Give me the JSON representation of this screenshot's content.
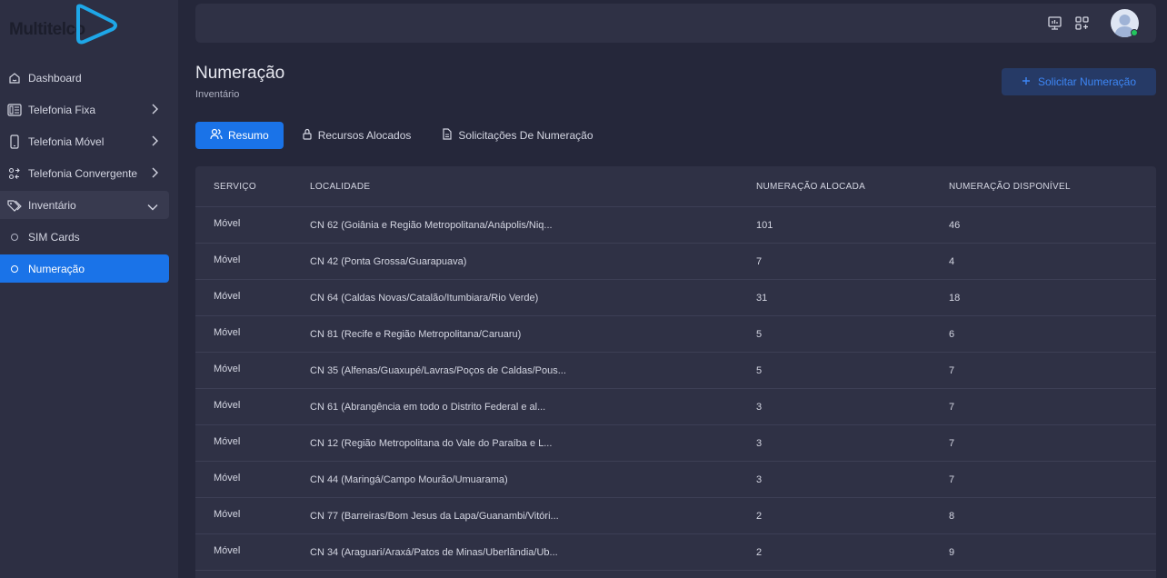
{
  "brand": {
    "name": "Multitelco"
  },
  "sidebar": {
    "items": [
      {
        "label": "Dashboard"
      },
      {
        "label": "Telefonia Fixa"
      },
      {
        "label": "Telefonia Móvel"
      },
      {
        "label": "Telefonia Convergente"
      },
      {
        "label": "Inventário"
      },
      {
        "label": "SIM Cards"
      },
      {
        "label": "Numeração"
      }
    ]
  },
  "header": {
    "title": "Numeração",
    "subtitle": "Inventário",
    "request_button": "Solicitar Numeração"
  },
  "tabs": [
    {
      "label": "Resumo"
    },
    {
      "label": "Recursos Alocados"
    },
    {
      "label": "Solicitações De Numeração"
    }
  ],
  "table": {
    "columns": [
      "SERVIÇO",
      "LOCALIDADE",
      "NUMERAÇÃO ALOCADA",
      "NUMERAÇÃO DISPONÍVEL"
    ],
    "rows": [
      {
        "servico": "Móvel",
        "localidade": "CN 62 (Goiânia e Região Metropolitana/Anápolis/Niq...",
        "alocada": "101",
        "disponivel": "46"
      },
      {
        "servico": "Móvel",
        "localidade": "CN 42 (Ponta Grossa/Guarapuava)",
        "alocada": "7",
        "disponivel": "4"
      },
      {
        "servico": "Móvel",
        "localidade": "CN 64 (Caldas Novas/Catalão/Itumbiara/Rio Verde)",
        "alocada": "31",
        "disponivel": "18"
      },
      {
        "servico": "Móvel",
        "localidade": "CN 81 (Recife e Região Metropolitana/Caruaru)",
        "alocada": "5",
        "disponivel": "6"
      },
      {
        "servico": "Móvel",
        "localidade": "CN 35 (Alfenas/Guaxupé/Lavras/Poços de Caldas/Pous...",
        "alocada": "5",
        "disponivel": "7"
      },
      {
        "servico": "Móvel",
        "localidade": "CN 61 (Abrangência em todo o Distrito Federal e al...",
        "alocada": "3",
        "disponivel": "7"
      },
      {
        "servico": "Móvel",
        "localidade": "CN 12 (Região Metropolitana do Vale do Paraíba e L...",
        "alocada": "3",
        "disponivel": "7"
      },
      {
        "servico": "Móvel",
        "localidade": "CN 44 (Maringá/Campo Mourão/Umuarama)",
        "alocada": "3",
        "disponivel": "7"
      },
      {
        "servico": "Móvel",
        "localidade": "CN 77 (Barreiras/Bom Jesus da Lapa/Guanambi/Vitóri...",
        "alocada": "2",
        "disponivel": "8"
      },
      {
        "servico": "Móvel",
        "localidade": "CN 34 (Araguari/Araxá/Patos de Minas/Uberlândia/Ub...",
        "alocada": "2",
        "disponivel": "9"
      }
    ]
  },
  "colors": {
    "accent": "#1a73e8",
    "online": "#22c55e",
    "logo_mark": "#1ea7e8"
  }
}
